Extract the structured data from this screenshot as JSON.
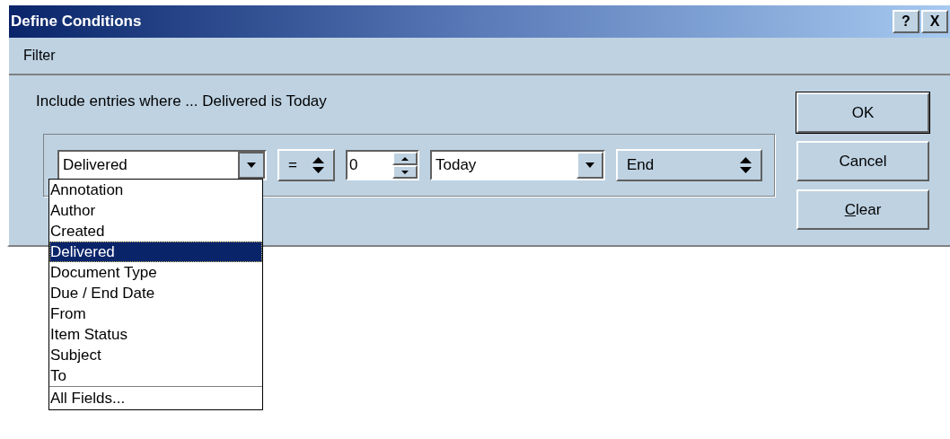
{
  "window": {
    "title": "Define Conditions",
    "title_buttons": [
      "?",
      "X"
    ]
  },
  "menu": [
    {
      "label": "Filter"
    }
  ],
  "summary": "Include entries where ... Delivered is Today",
  "condition": {
    "field": {
      "value": "Delivered",
      "expanded": true
    },
    "operator": "=",
    "number": "0",
    "date": "Today",
    "connector": "End"
  },
  "field_list": {
    "items": [
      {
        "label": "Annotation",
        "selected": false
      },
      {
        "label": "Author",
        "selected": false
      },
      {
        "label": "Created",
        "selected": false
      },
      {
        "label": "Delivered",
        "selected": true
      },
      {
        "label": "Document Type",
        "selected": false
      },
      {
        "label": "Due / End Date",
        "selected": false
      },
      {
        "label": "From",
        "selected": false
      },
      {
        "label": "Item Status",
        "selected": false
      },
      {
        "label": "Subject",
        "selected": false
      },
      {
        "label": "To",
        "selected": false
      }
    ],
    "footer": "All Fields..."
  },
  "buttons": [
    {
      "label": "OK",
      "default": true,
      "mnemonic": false
    },
    {
      "label": "Cancel",
      "default": false,
      "mnemonic": false
    },
    {
      "label": "Clear",
      "default": false,
      "mnemonic": true
    }
  ]
}
